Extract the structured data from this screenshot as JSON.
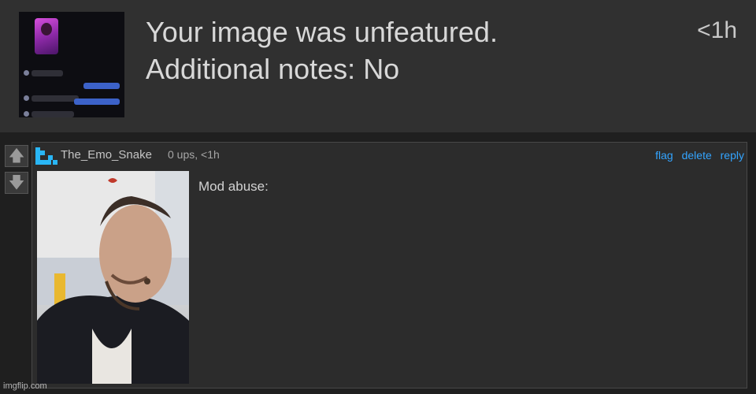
{
  "notification": {
    "line1": "Your image was unfeatured.",
    "line2": "Additional notes: No",
    "time": "<1h"
  },
  "comment": {
    "username": "The_Emo_Snake",
    "meta": "0 ups, <1h",
    "actions": {
      "flag": "flag",
      "delete": "delete",
      "reply": "reply"
    },
    "text": "Mod abuse:"
  },
  "icons": {
    "upvote": "arrow-up-icon",
    "downvote": "arrow-down-icon",
    "user": "pixel-snake-icon"
  },
  "colors": {
    "link": "#33a4ff",
    "user_icon": "#29b6f6",
    "upvote_bg": "#3a3a3a"
  },
  "watermark": "imgflip.com"
}
